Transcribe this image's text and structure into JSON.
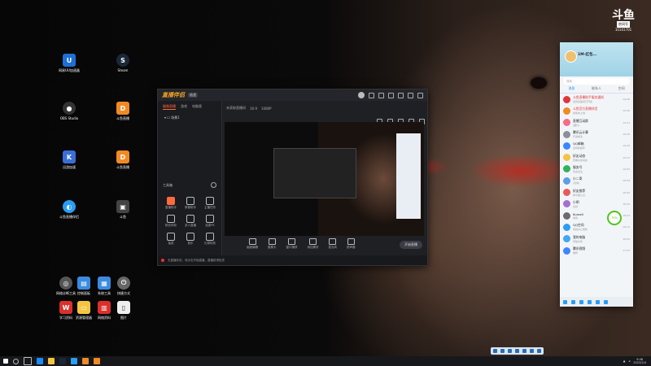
{
  "desktop": {
    "icons_col1": [
      "网易UU加速器",
      "OBS Studio",
      "迅游加速",
      "斗鱼直播伴侣",
      "网络诊断工具",
      "WPS",
      "学习资料"
    ],
    "icons_col2": [
      "Steam",
      "斗鱼直播",
      "斗鱼直播",
      "斗鱼",
      "控制面板",
      "资源管理器",
      "回收站"
    ],
    "icons_col3": [
      "系统工具",
      "网络资料"
    ],
    "icons_col4": [
      "快捷方式",
      "图片"
    ]
  },
  "streamer_window": {
    "app_title": "直播伴侣",
    "version_badge": "极速",
    "left_tabs": [
      "摄像直播",
      "游戏",
      "电脑版"
    ],
    "active_tab": "摄像直播",
    "scene": "场景1",
    "tools_heading": "工具箱",
    "tools": [
      {
        "label": "直播助手",
        "hot": true
      },
      {
        "label": "房管助手",
        "hot": false
      },
      {
        "label": "主播任务",
        "hot": false
      },
      {
        "label": "粉丝特权",
        "hot": false
      },
      {
        "label": "多人直播",
        "hot": false
      },
      {
        "label": "连麦PK",
        "hot": false
      },
      {
        "label": "抽奖",
        "hot": false
      },
      {
        "label": "音乐",
        "hot": false
      },
      {
        "label": "礼物特效",
        "hot": false
      }
    ],
    "preview_toolbar": [
      "未获取直播间",
      "16:9",
      "1080P"
    ],
    "controls": [
      "画面编辑",
      "摄像头",
      "窗口捕获",
      "添加素材",
      "麦克风",
      "扬声器"
    ],
    "start_button": "开始直播",
    "status_text": "无直播状态，请点击开始直播，直播前请检查"
  },
  "chat_panel": {
    "nickname": "1M-红包...",
    "search_placeholder": "搜索",
    "tabs": [
      "消息",
      "联系人",
      "空间"
    ],
    "active_tab": "消息",
    "items": [
      {
        "name": "斗鱼直播助手服务通知",
        "sub": "您的直播间已开启",
        "time": "19:46",
        "red": true,
        "color": "#e0353a"
      },
      {
        "name": "斗鱼官方直播伴侣",
        "sub": "新版本上线",
        "time": "19:46",
        "red": true,
        "color": "#f08a24"
      },
      {
        "name": "直播互动群",
        "sub": "[图片]",
        "time": "19:41",
        "red": false,
        "color": "#f56c8a"
      },
      {
        "name": "腾讯云计算",
        "sub": "开通成功",
        "time": "19:30",
        "red": false,
        "color": "#8a8f99"
      },
      {
        "name": "QQ邮箱",
        "sub": "您有新邮件",
        "time": "19:20",
        "red": false,
        "color": "#3a86ff"
      },
      {
        "name": "好友动态",
        "sub": "查看好友动态",
        "time": "19:12",
        "red": false,
        "color": "#f5c242"
      },
      {
        "name": "服务号",
        "sub": "欢迎关注",
        "time": "19:05",
        "red": false,
        "color": "#2fb35c"
      },
      {
        "name": "小二哥",
        "sub": "[表情]",
        "time": "18:58",
        "red": false,
        "color": "#5aa0e6"
      },
      {
        "name": "好友推荐",
        "sub": "你可能认识",
        "time": "18:40",
        "red": false,
        "color": "#e55b5b"
      },
      {
        "name": "小明",
        "sub": "好的",
        "time": "18:30",
        "red": false,
        "color": "#a36fd1"
      },
      {
        "name": "Kuroeli",
        "sub": "收到",
        "time": "18:20",
        "red": false,
        "color": "#6c6c6c"
      },
      {
        "name": "QQ空间",
        "sub": "特别关心更新",
        "time": "18:10",
        "red": false,
        "color": "#2a9df4"
      },
      {
        "name": "我的电脑",
        "sub": "传输文件",
        "time": "18:00",
        "red": false,
        "color": "#42a5f5"
      },
      {
        "name": "腾讯视频",
        "sub": "推荐",
        "time": "17:50",
        "red": false,
        "color": "#3d86ff"
      }
    ],
    "progress_percent": "75%"
  },
  "watermark": {
    "logo": "斗鱼",
    "tag": "房间号",
    "room_id": "10101701"
  },
  "taskbar": {
    "time": "9:46",
    "date": "2022/2/4"
  }
}
